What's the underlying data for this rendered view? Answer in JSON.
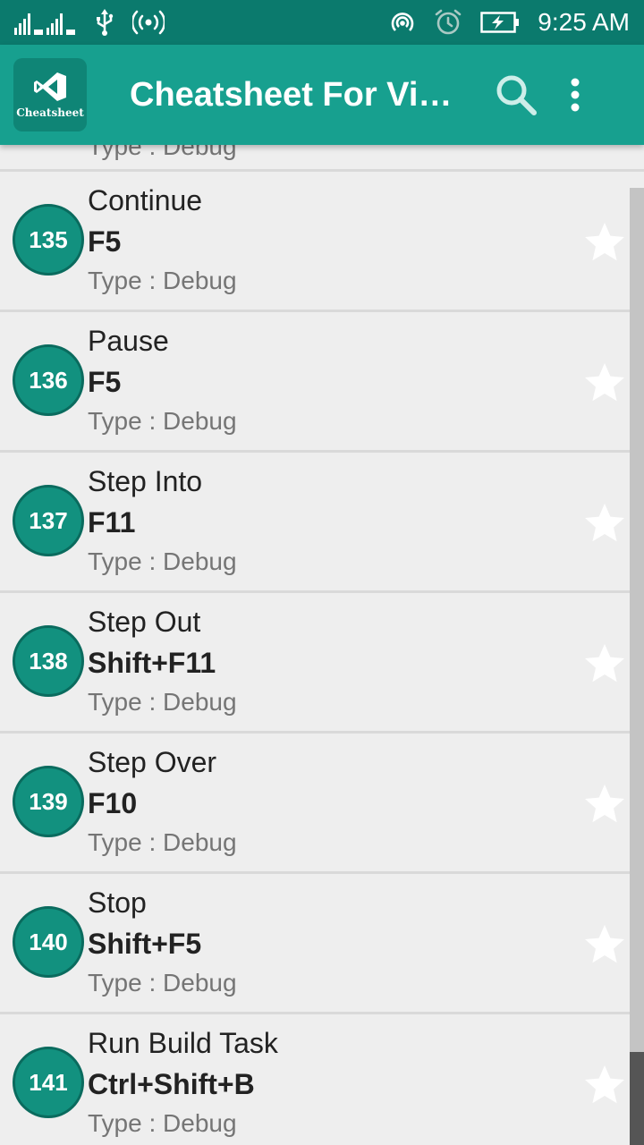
{
  "status_bar": {
    "time": "9:25 AM",
    "icons": [
      "signal-icon",
      "usb-icon",
      "hotspot-icon",
      "wifi-hotspot-icon",
      "alarm-icon",
      "battery-charging-icon"
    ]
  },
  "app_bar": {
    "logo_text": "Cheatsheet",
    "title": "Cheatsheet For Vis…",
    "icons": [
      "search-icon",
      "more-vert-icon"
    ]
  },
  "colors": {
    "status_bar": "#0b7a6d",
    "app_bar": "#17a08f",
    "badge": "#12917f",
    "background": "#eeeeee"
  },
  "list": {
    "partial_item": {
      "type": "Type : Debug"
    },
    "items": [
      {
        "number": "135",
        "title": "Continue",
        "shortcut": "F5",
        "type": "Type : Debug"
      },
      {
        "number": "136",
        "title": "Pause",
        "shortcut": "F5",
        "type": "Type : Debug"
      },
      {
        "number": "137",
        "title": "Step Into",
        "shortcut": "F11",
        "type": "Type : Debug"
      },
      {
        "number": "138",
        "title": "Step Out",
        "shortcut": "Shift+F11",
        "type": "Type : Debug"
      },
      {
        "number": "139",
        "title": "Step Over",
        "shortcut": "F10",
        "type": "Type : Debug"
      },
      {
        "number": "140",
        "title": "Stop",
        "shortcut": "Shift+F5",
        "type": "Type : Debug"
      },
      {
        "number": "141",
        "title": "Run Build Task",
        "shortcut": "Ctrl+Shift+B",
        "type": "Type : Debug"
      }
    ]
  }
}
